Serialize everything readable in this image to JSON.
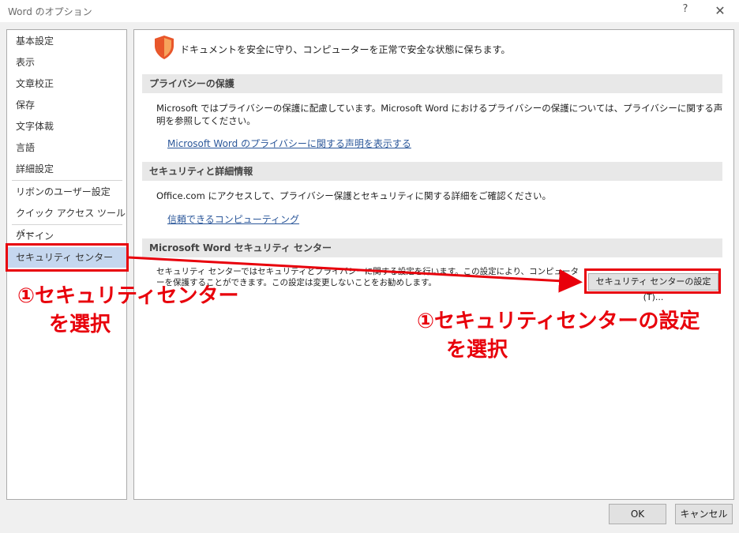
{
  "window": {
    "title": "Word のオプション",
    "help_label": "?",
    "close_label": "✕"
  },
  "sidebar": {
    "items": [
      {
        "label": "基本設定"
      },
      {
        "label": "表示"
      },
      {
        "label": "文章校正"
      },
      {
        "label": "保存"
      },
      {
        "label": "文字体裁"
      },
      {
        "label": "言語"
      },
      {
        "label": "詳細設定"
      },
      {
        "label": "リボンのユーザー設定"
      },
      {
        "label": "クイック アクセス ツール バー"
      },
      {
        "label": "アドイン"
      },
      {
        "label": "セキュリティ センター",
        "selected": true
      }
    ]
  },
  "main": {
    "intro": "ドキュメントを安全に守り、コンピューターを正常で安全な状態に保ちます。",
    "sections": [
      {
        "header": "プライバシーの保護",
        "text": "Microsoft ではプライバシーの保護に配慮しています。Microsoft Word におけるプライバシーの保護については、プライバシーに関する声明を参照してください。",
        "link": "Microsoft Word のプライバシーに関する声明を表示する"
      },
      {
        "header": "セキュリティと詳細情報",
        "text": "Office.com にアクセスして、プライバシー保護とセキュリティに関する詳細をご確認ください。",
        "link": "信頼できるコンピューティング"
      },
      {
        "header": "Microsoft Word セキュリティ センター",
        "text": "セキュリティ センターではセキュリティとプライバシーに関する設定を行います。この設定により、コンピューターを保護することができます。この設定は変更しないことをお勧めします。",
        "button": "セキュリティ センターの設定(T)..."
      }
    ]
  },
  "footer": {
    "ok_label": "OK",
    "cancel_label": "キャンセル"
  },
  "annotations": {
    "left_line1": "①セキュリティセンター",
    "left_line2": "を選択",
    "right_line1": "①セキュリティセンターの設定",
    "right_line2": "を選択",
    "color": "#e8000b"
  },
  "colors": {
    "selected_nav": "#c5d7ef",
    "link": "#2b579a",
    "shield": "#e8562a"
  }
}
